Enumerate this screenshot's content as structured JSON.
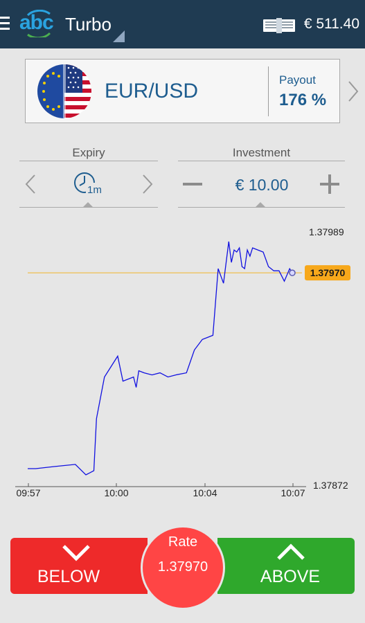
{
  "header": {
    "logo_text": "abc",
    "app_title": "Turbo",
    "balance": "€ 511.40"
  },
  "asset": {
    "name": "EUR/USD",
    "payout_label": "Payout",
    "payout_value": "176 %"
  },
  "expiry": {
    "label": "Expiry",
    "value": "1m"
  },
  "investment": {
    "label": "Investment",
    "value": "€ 10.00"
  },
  "chart_data": {
    "type": "line",
    "x_ticks": [
      "09:57",
      "10:00",
      "10:04",
      "10:07"
    ],
    "y_high_label": "1.37989",
    "y_low_label": "1.37872",
    "current_rate_label": "1.37970",
    "ylim": [
      1.37872,
      1.37989
    ],
    "series": [
      {
        "color": "#1010e0",
        "x": [
          0,
          0.03,
          0.1,
          0.18,
          0.22,
          0.25,
          0.26,
          0.29,
          0.34,
          0.36,
          0.4,
          0.41,
          0.42,
          0.44,
          0.47,
          0.5,
          0.53,
          0.56,
          0.6,
          0.63,
          0.66,
          0.7,
          0.72,
          0.74,
          0.76,
          0.77,
          0.78,
          0.79,
          0.8,
          0.81,
          0.82,
          0.83,
          0.84,
          0.85,
          0.87,
          0.89,
          0.91,
          0.93,
          0.95,
          0.97,
          0.99,
          1.0
        ],
        "y": [
          1.37876,
          1.37876,
          1.37877,
          1.37878,
          1.37873,
          1.37875,
          1.379,
          1.3792,
          1.3793,
          1.37918,
          1.3792,
          1.37915,
          1.37923,
          1.37922,
          1.37921,
          1.37922,
          1.3792,
          1.37921,
          1.37922,
          1.37933,
          1.37938,
          1.3794,
          1.37972,
          1.37965,
          1.37985,
          1.37975,
          1.37981,
          1.3798,
          1.37982,
          1.37973,
          1.37972,
          1.37981,
          1.37978,
          1.37982,
          1.37981,
          1.3798,
          1.37973,
          1.37971,
          1.37971,
          1.37966,
          1.37972,
          1.3797
        ]
      }
    ],
    "grid": false
  },
  "buttons": {
    "below_label": "BELOW",
    "above_label": "ABOVE",
    "rate_label": "Rate",
    "rate_value": "1.37970"
  },
  "colors": {
    "header_bg": "#1f3b52",
    "accent_blue": "#1e5d8f",
    "below_red": "#ee2a2a",
    "above_green": "#2fa82c",
    "rate_circle": "#ff4545",
    "rate_line": "#f0b429",
    "chart_line": "#1010e0"
  },
  "icons": [
    "menu-icon",
    "abc-logo",
    "money-stack-icon",
    "eu-us-flag-icon",
    "chevron-right-icon",
    "chevron-left-icon",
    "clock-icon",
    "minus-icon",
    "plus-icon",
    "chevron-down-icon",
    "chevron-up-icon"
  ]
}
